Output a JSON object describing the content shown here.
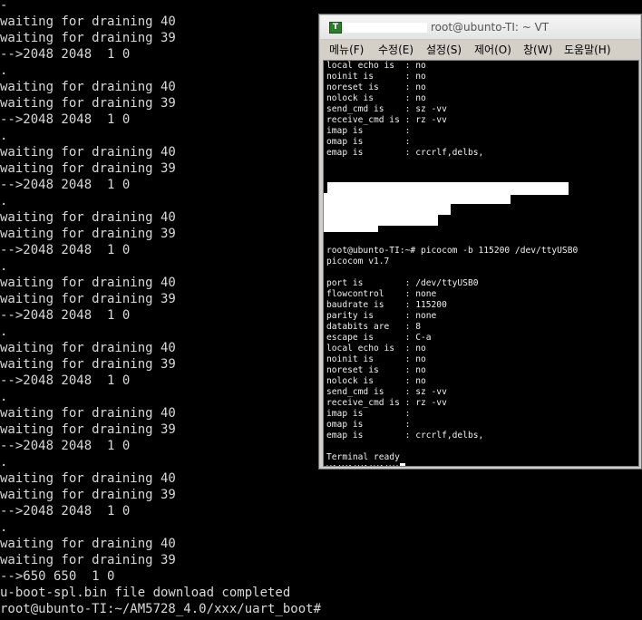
{
  "background_terminal": {
    "lines": [
      "-",
      "waiting for draining 40",
      "waiting for draining 39",
      "-->2048 2048  1 0",
      ".",
      "waiting for draining 40",
      "waiting for draining 39",
      "-->2048 2048  1 0",
      ".",
      "waiting for draining 40",
      "waiting for draining 39",
      "-->2048 2048  1 0",
      ".",
      "waiting for draining 40",
      "waiting for draining 39",
      "-->2048 2048  1 0",
      ".",
      "waiting for draining 40",
      "waiting for draining 39",
      "-->2048 2048  1 0",
      ".",
      "waiting for draining 40",
      "waiting for draining 39",
      "-->2048 2048  1 0",
      ".",
      "waiting for draining 40",
      "waiting for draining 39",
      "-->2048 2048  1 0",
      ".",
      "waiting for draining 40",
      "waiting for draining 39",
      "-->2048 2048  1 0",
      ".",
      "waiting for draining 40",
      "waiting for draining 39",
      "-->650 650  1 0",
      "u-boot-spl.bin file download completed",
      "root@ubunto-TI:~/AM5728_4.0/xxx/uart_boot#"
    ]
  },
  "vt_window": {
    "title": "root@ubunto-TI: ~ VT",
    "app_icon_label": "T",
    "menu": [
      "메뉴(F)",
      "수정(E)",
      "설정(S)",
      "제어(O)",
      "창(W)",
      "도움말(H)"
    ],
    "screen_lines": [
      "local echo is  : no",
      "noinit is      : no",
      "noreset is     : no",
      "nolock is      : no",
      "send_cmd is    : sz -vv",
      "receive_cmd is : rz -vv",
      "imap is        :",
      "omap is        :",
      "emap is        : crcrlf,delbs,",
      "",
      "",
      "",
      "",
      "",
      "",
      "",
      "",
      "root@ubunto-TI:~# picocom -b 115200 /dev/ttyUSB0",
      "picocom v1.7",
      "",
      "port is        : /dev/ttyUSB0",
      "flowcontrol    : none",
      "baudrate is    : 115200",
      "parity is      : none",
      "databits are   : 8",
      "escape is      : C-a",
      "local echo is  : no",
      "noinit is      : no",
      "noreset is     : no",
      "nolock is      : no",
      "send_cmd is    : sz -vv",
      "receive_cmd is : rz -vv",
      "imap is        :",
      "omap is        :",
      "emap is        : crcrlf,delbs,",
      "",
      "Terminal ready",
      "VA!VA!VA!VA!V!"
    ]
  }
}
